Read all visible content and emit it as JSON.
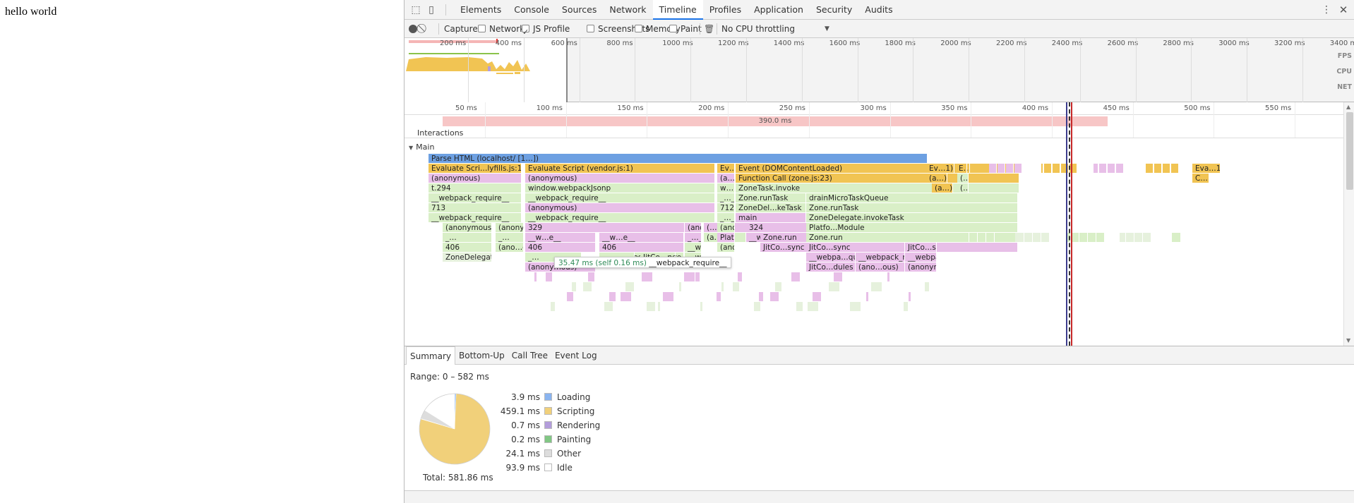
{
  "page": {
    "content": "hello world"
  },
  "devtools": {
    "tabs": [
      "Elements",
      "Console",
      "Sources",
      "Network",
      "Timeline",
      "Profiles",
      "Application",
      "Security",
      "Audits"
    ],
    "active_tab": "Timeline",
    "toolbar": {
      "capture_label": "Capture:",
      "checkboxes": [
        {
          "label": "Network",
          "checked": false
        },
        {
          "label": "JS Profile",
          "checked": true
        },
        {
          "label": "Screenshots",
          "checked": false
        },
        {
          "label": "Memory",
          "checked": false
        },
        {
          "label": "Paint",
          "checked": false
        }
      ],
      "throttling": "No CPU throttling"
    },
    "overview": {
      "ticks": [
        "200 ms",
        "400 ms",
        "600 ms",
        "800 ms",
        "1000 ms",
        "1200 ms",
        "1400 ms",
        "1600 ms",
        "1800 ms",
        "2000 ms",
        "2200 ms",
        "2400 ms",
        "2600 ms",
        "2800 ms",
        "3000 ms",
        "3200 ms",
        "3400 ms"
      ],
      "lanes": [
        "FPS",
        "CPU",
        "NET"
      ]
    },
    "timeline": {
      "ticks": [
        "50 ms",
        "100 ms",
        "150 ms",
        "200 ms",
        "250 ms",
        "300 ms",
        "350 ms",
        "400 ms",
        "450 ms",
        "500 ms",
        "550 ms"
      ],
      "interaction_duration": "390.0 ms",
      "interactions_label": "Interactions",
      "main_label": "Main",
      "flame_labels": [
        "Parse HTML (localhost/ [1…])",
        "Evaluate Scri…lyfills.js:1)",
        "Evaluate Script (vendor.js:1)",
        "Ev…)",
        "Event (DOMContentLoaded)",
        "Ev…1)",
        "E…",
        "Eva…1)",
        "(anonymous)",
        "(anonymous)",
        "(a…)",
        "Function Call (zone.js:23)",
        "(a…)",
        "(…",
        "C…",
        "t.294",
        "window.webpackJsonp",
        "w…p",
        "ZoneTask.invoke",
        "(a…)",
        "(…",
        "__webpack_require__",
        "__webpack_require__",
        "_…_",
        "Zone.runTask",
        "drainMicroTaskQueue",
        "713",
        "(anonymous)",
        "712",
        "ZoneDel…keTask",
        "Zone.runTask",
        "__webpack_require__",
        "__webpack_require__",
        "_…_",
        "main",
        "ZoneDelegate.invokeTask",
        "325",
        "329",
        "(anonymous)",
        "(…)",
        "(anon…ous)",
        "324",
        "Platfo…Module",
        "(anonymous)",
        "(ano…ous)",
        "(a…s)",
        "__webpa…quire__",
        "__webpack_require__",
        "_…",
        "__w…e__",
        "_…_",
        "Platfor…thZone",
        "Zone.run",
        "(ano…ous)",
        "n",
        "__webpa…quire__",
        "(anonymous)",
        "(…)",
        "406",
        "JitCo…sync",
        "ZoneDelegate.invoke",
        "__we…re__",
        "(a…)",
        "__webpa…quire__",
        "__webpack_require__",
        "_…",
        "_…_",
        "JitCo…nents",
        "i",
        "(ano…ous)",
        "(anonymous)",
        "(anonymous)",
        "JitCo…dules",
        "JitCompiler._compileComponents",
        "J…",
        "__we…e__",
        "__webp…ire__",
        "__webpac…equire__",
        "_…",
        "(an…us)",
        "(anonymous)",
        "(an…s)",
        "(anon",
        "C…a",
        "(anonymous)",
        "Jit…te",
        "__web…ire__",
        "__w…",
        "__w…",
        "(a…)",
        "JitCom…rapper",
        "Jit…per",
        "(anonymous)",
        "C…a"
      ],
      "tooltip": {
        "duration": "35.47 ms (self 0.16 ms)",
        "name": "__webpack_require__"
      }
    },
    "bottom_tabs": [
      "Summary",
      "Bottom-Up",
      "Call Tree",
      "Event Log"
    ],
    "active_bottom_tab": "Summary",
    "summary": {
      "range": "Range: 0 – 582 ms",
      "total": "Total: 581.86 ms",
      "items": [
        {
          "value": "3.9 ms",
          "label": "Loading",
          "color": "#8ab4f0",
          "ms": 3.9
        },
        {
          "value": "459.1 ms",
          "label": "Scripting",
          "color": "#f1d07a",
          "ms": 459.1
        },
        {
          "value": "0.7 ms",
          "label": "Rendering",
          "color": "#b39ddb",
          "ms": 0.7
        },
        {
          "value": "0.2 ms",
          "label": "Painting",
          "color": "#81c784",
          "ms": 0.2
        },
        {
          "value": "24.1 ms",
          "label": "Other",
          "color": "#dddddd",
          "ms": 24.1
        },
        {
          "value": "93.9 ms",
          "label": "Idle",
          "color": "#ffffff",
          "ms": 93.9
        }
      ]
    }
  }
}
